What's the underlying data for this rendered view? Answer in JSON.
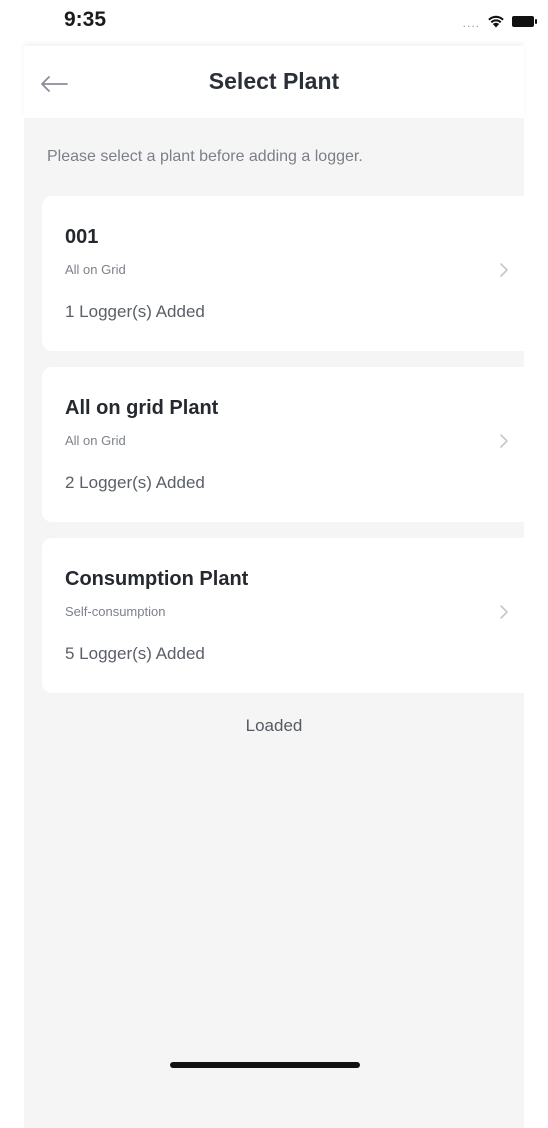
{
  "status_bar": {
    "time": "9:35",
    "signal_dots": "....",
    "icons": [
      "wifi-icon",
      "battery-icon"
    ]
  },
  "nav": {
    "back_icon": "arrow-left-icon",
    "title": "Select Plant"
  },
  "hint": "Please select a plant before adding a logger.",
  "plants": [
    {
      "name": "001",
      "type": "All on Grid",
      "loggers": "1 Logger(s) Added"
    },
    {
      "name": "All on grid Plant",
      "type": "All on Grid",
      "loggers": "2 Logger(s) Added"
    },
    {
      "name": "Consumption Plant",
      "type": "Self-consumption",
      "loggers": "5 Logger(s) Added"
    }
  ],
  "list_status": "Loaded",
  "colors": {
    "background": "#f5f5f6",
    "card": "#ffffff",
    "title_text": "#2b2f36",
    "secondary_text": "#7d828a"
  }
}
